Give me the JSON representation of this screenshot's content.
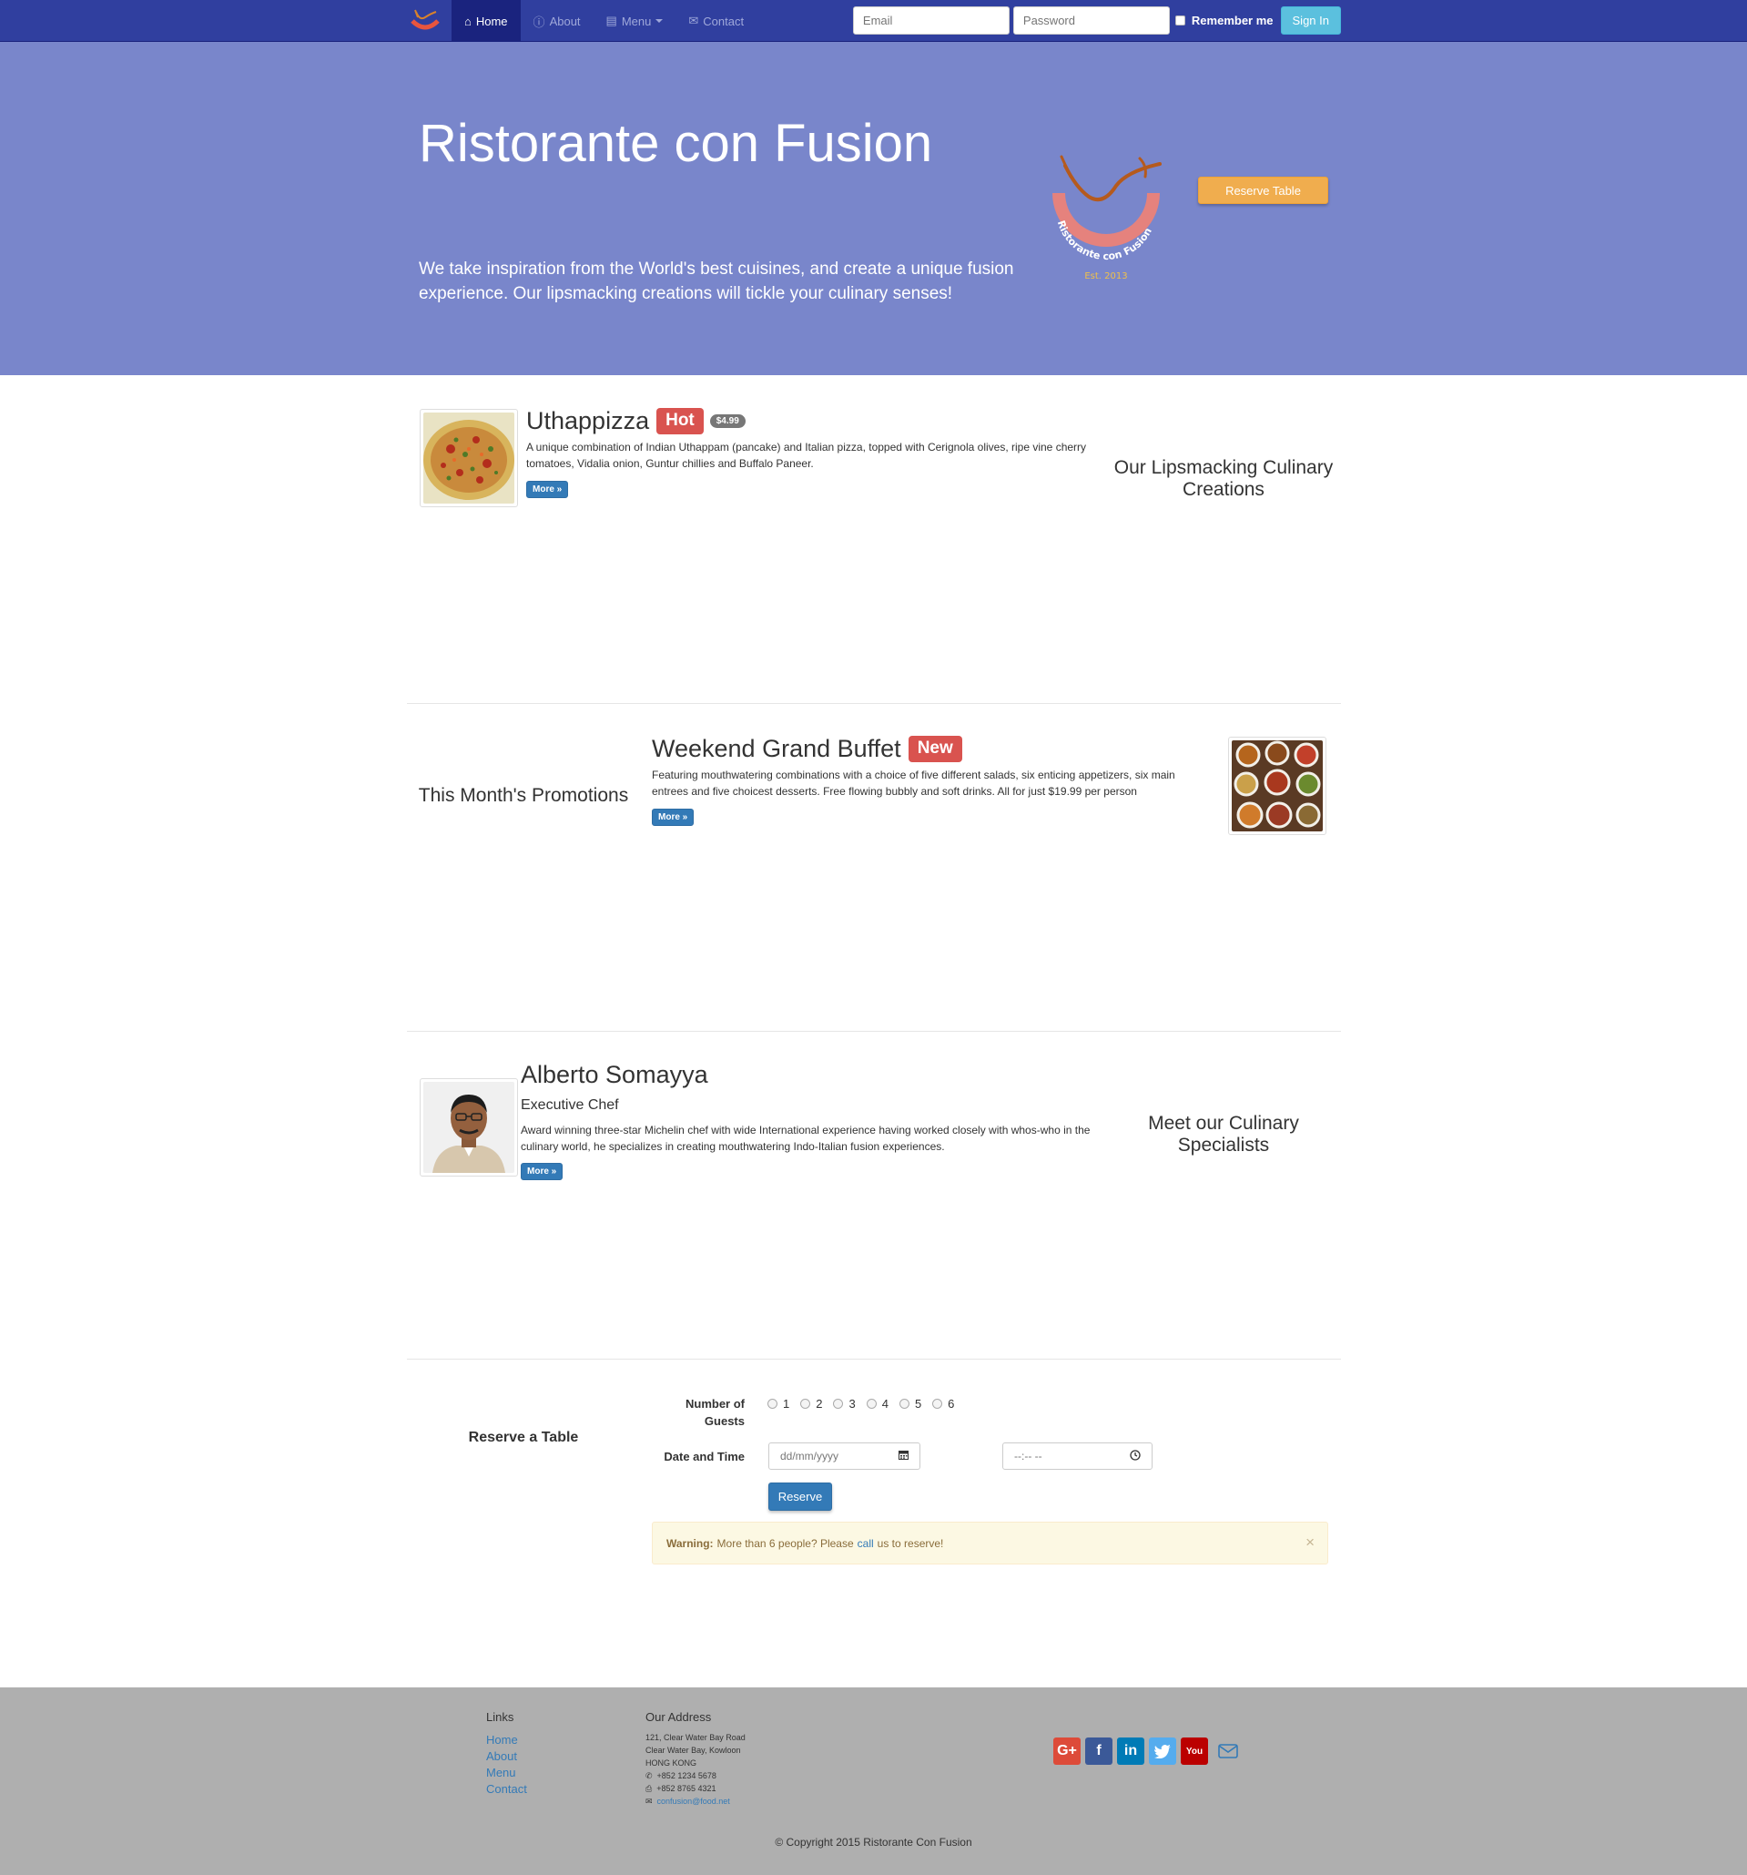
{
  "navbar": {
    "brand_alt": "Ristorante con Fusion logo",
    "links": [
      {
        "label": "Home",
        "icon": "home-icon",
        "active": true
      },
      {
        "label": "About",
        "icon": "info-circle-icon",
        "active": false
      },
      {
        "label": "Menu",
        "icon": "list-alt-icon",
        "active": false,
        "dropdown": true
      },
      {
        "label": "Contact",
        "icon": "envelope-icon",
        "active": false
      }
    ],
    "login": {
      "email_placeholder": "Email",
      "password_placeholder": "Password",
      "remember_label": "Remember me",
      "signin_label": "Sign In"
    }
  },
  "jumbotron": {
    "title": "Ristorante con Fusion",
    "lead": "We take inspiration from the World's best cuisines, and create a unique fusion experience. Our lipsmacking creations will tickle your culinary senses!",
    "logo_text": "Ristorante con Fusion",
    "logo_est": "Est. 2013",
    "reserve_button": "Reserve Table"
  },
  "dish": {
    "title": "Uthappizza",
    "label": "Hot",
    "price": "$4.99",
    "description": "A unique combination of Indian Uthappam (pancake) and Italian pizza, topped with Cerignola olives, ripe vine cherry tomatoes, Vidalia onion, Guntur chillies and Buffalo Paneer.",
    "more": "More »",
    "side_heading": "Our Lipsmacking Culinary Creations"
  },
  "promotion": {
    "title": "Weekend Grand Buffet",
    "label": "New",
    "description": "Featuring mouthwatering combinations with a choice of five different salads, six enticing appetizers, six main entrees and five choicest desserts. Free flowing bubbly and soft drinks. All for just $19.99 per person",
    "more": "More »",
    "side_heading": "This Month's Promotions"
  },
  "leader": {
    "name": "Alberto Somayya",
    "designation": "Executive Chef",
    "description": "Award winning three-star Michelin chef with wide International experience having worked closely with whos-who in the culinary world, he specializes in creating mouthwatering Indo-Italian fusion experiences.",
    "more": "More »",
    "side_heading": "Meet our Culinary Specialists"
  },
  "reservation": {
    "heading": "Reserve a Table",
    "guests_label": "Number of Guests",
    "guest_options": [
      "1",
      "2",
      "3",
      "4",
      "5",
      "6"
    ],
    "datetime_label": "Date and Time",
    "date_placeholder": "dd/mm/yyyy",
    "time_placeholder": "--:-- --",
    "submit": "Reserve",
    "warning_strong": "Warning:",
    "warning_text_1": "More than 6 people? Please",
    "warning_link": "call",
    "warning_text_2": "us to reserve!"
  },
  "footer": {
    "links_heading": "Links",
    "links": [
      "Home",
      "About",
      "Menu",
      "Contact"
    ],
    "address_heading": "Our Address",
    "address_lines": [
      "121, Clear Water Bay Road",
      "Clear Water Bay, Kowloon",
      "HONG KONG"
    ],
    "phone": "+852 1234 5678",
    "fax": "+852 8765 4321",
    "email": "confusion@food.net",
    "socials": [
      {
        "name": "google-plus",
        "glyph": "G+",
        "color": "#dd4b39"
      },
      {
        "name": "facebook",
        "glyph": "f",
        "color": "#3b5998"
      },
      {
        "name": "linkedin",
        "glyph": "in",
        "color": "#007bb6"
      },
      {
        "name": "twitter",
        "glyph": "t",
        "color": "#55acee"
      },
      {
        "name": "youtube",
        "glyph": "You",
        "color": "#bb0000"
      }
    ],
    "copyright": "© Copyright 2015 Ristorante Con Fusion"
  },
  "colors": {
    "navbar": "#303f9f",
    "navbar_active": "#1a237e",
    "jumbotron": "#7986cb",
    "footer": "#afafaf",
    "primary": "#337ab7",
    "warning": "#f0ad4e",
    "danger": "#d9534f",
    "info": "#5bc0de"
  }
}
